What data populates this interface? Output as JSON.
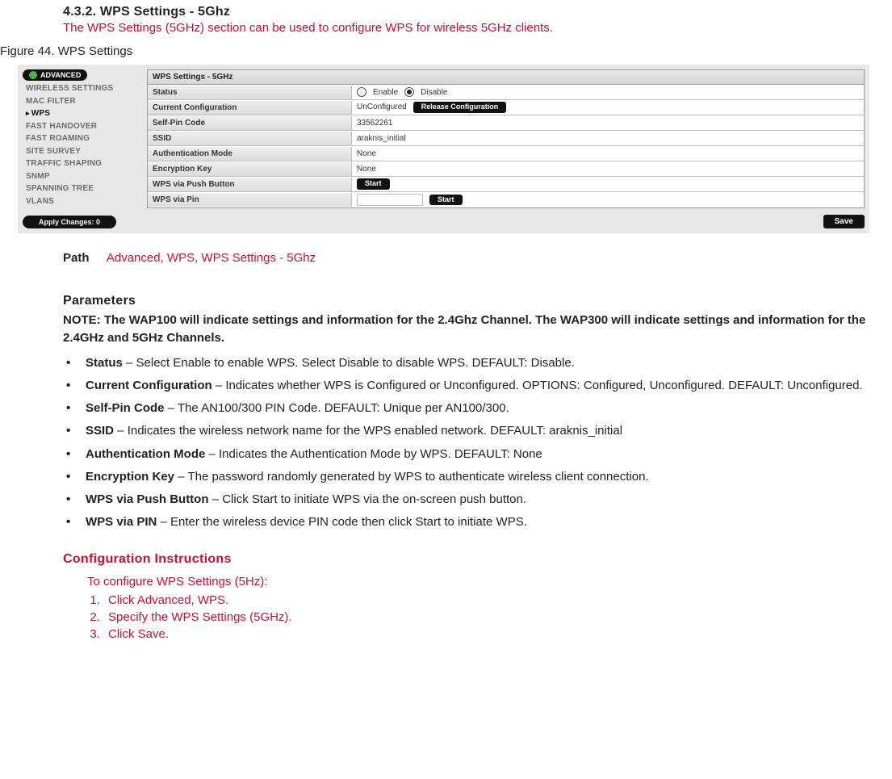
{
  "section": {
    "number_title": "4.3.2. WPS Settings - 5Ghz",
    "subtitle": "The WPS Settings (5GHz) section can be used to configure WPS for wireless 5GHz clients."
  },
  "figure_caption": "Figure 44. WPS Settings",
  "screenshot": {
    "adv_badge": "ADVANCED",
    "sidebar": [
      "WIRELESS SETTINGS",
      "MAC FILTER",
      "WPS",
      "FAST HANDOVER",
      "FAST ROAMING",
      "SITE SURVEY",
      "TRAFFIC SHAPING",
      "SNMP",
      "SPANNING TREE",
      "VLANS"
    ],
    "apply": "Apply Changes: 0",
    "panel_title": "WPS Settings - 5GHz",
    "rows": {
      "status_label": "Status",
      "status_enable": "Enable",
      "status_disable": "Disable",
      "curconf_label": "Current Configuration",
      "curconf_value": "UnConfigured",
      "curconf_btn": "Release Configuration",
      "selfpin_label": "Self-Pin Code",
      "selfpin_value": "33562261",
      "ssid_label": "SSID",
      "ssid_value": "araknis_initial",
      "auth_label": "Authentication Mode",
      "auth_value": "None",
      "enc_label": "Encryption Key",
      "enc_value": "None",
      "push_label": "WPS via Push Button",
      "push_btn": "Start",
      "pin_label": "WPS via Pin",
      "pin_btn": "Start"
    },
    "save": "Save"
  },
  "path": {
    "label": "Path",
    "value": "Advanced, WPS, WPS Settings - 5Ghz"
  },
  "parameters": {
    "heading": "Parameters",
    "note": "NOTE: The WAP100 will indicate settings and information for the 2.4Ghz Channel. The WAP300 will indicate settings and information for the 2.4GHz and 5GHz Channels.",
    "items": [
      {
        "term": "Status",
        "desc": " – Select Enable to enable WPS. Select Disable to disable WPS. DEFAULT: Disable."
      },
      {
        "term": "Current Configuration",
        "desc": " – Indicates whether WPS is Configured or Unconfigured. OPTIONS: Configured, Unconfigured. DEFAULT: Unconfigured."
      },
      {
        "term": "Self-Pin Code",
        "desc": " – The AN100/300 PIN Code. DEFAULT: Unique per AN100/300."
      },
      {
        "term": "SSID",
        "desc": " – Indicates the wireless network name for the WPS enabled network. DEFAULT: araknis_initial"
      },
      {
        "term": "Authentication Mode",
        "desc": " – Indicates the Authentication Mode by WPS. DEFAULT: None"
      },
      {
        "term": "Encryption Key",
        "desc": " – The password randomly generated by WPS to authenticate wireless client connection."
      },
      {
        "term": "WPS via Push Button",
        "desc": " – Click Start to initiate WPS via the on-screen push button."
      },
      {
        "term": "WPS via PIN",
        "desc": " – Enter the wireless device PIN code then click Start to initiate WPS."
      }
    ]
  },
  "config": {
    "heading": "Configuration Instructions",
    "intro": "To configure WPS Settings (5Hz):",
    "steps": [
      "Click Advanced, WPS.",
      "Specify the WPS Settings (5GHz).",
      "Click Save."
    ]
  }
}
